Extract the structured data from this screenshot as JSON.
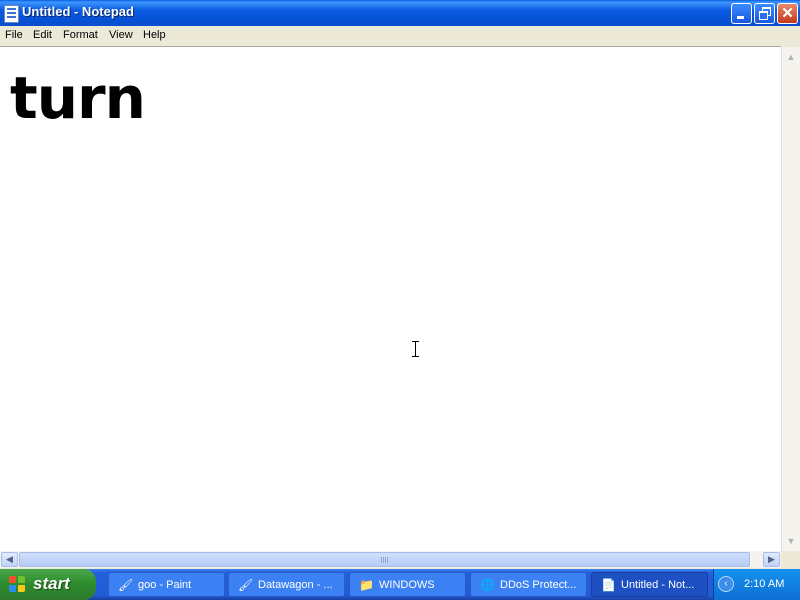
{
  "window": {
    "title": "Untitled - Notepad",
    "controls": [
      "minimize",
      "maximize",
      "close"
    ]
  },
  "menu": {
    "items": [
      "File",
      "Edit",
      "Format",
      "View",
      "Help"
    ]
  },
  "editor": {
    "content": "turn"
  },
  "taskbar": {
    "start_label": "start",
    "tasks": [
      {
        "label": "goo - Paint",
        "icon": "paint-icon"
      },
      {
        "label": "Datawagon - ...",
        "icon": "paint-icon"
      },
      {
        "label": "WINDOWS",
        "icon": "folder-icon"
      },
      {
        "label": "DDoS Protect...",
        "icon": "browser-icon"
      },
      {
        "label": "Untitled - Not...",
        "icon": "notepad-icon",
        "active": true
      }
    ],
    "clock": "2:10 AM"
  },
  "colors": {
    "titlebar": "#0a5ae0",
    "taskbar": "#225bd6",
    "start_button": "#2d8a2d",
    "close_button": "#c6381a"
  }
}
